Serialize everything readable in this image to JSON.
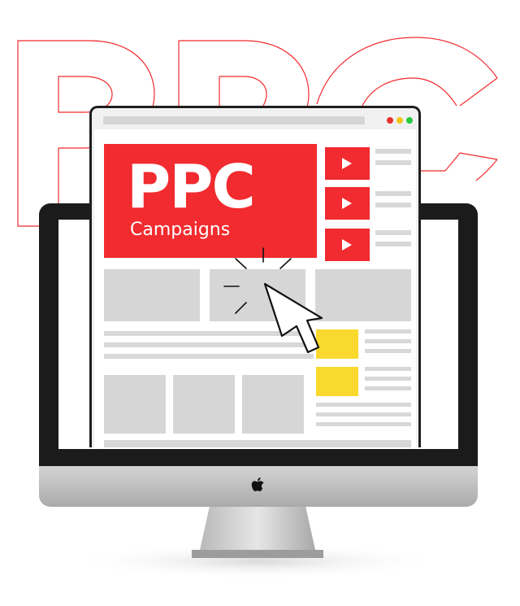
{
  "background_text": "PPC",
  "hero": {
    "title": "PPC",
    "subtitle": "Campaigns"
  },
  "icons": {
    "play": "play-icon",
    "cursor": "mouse-pointer-icon",
    "apple": "apple-logo-icon"
  },
  "colors": {
    "accent_red": "#f12b2f",
    "highlight_yellow": "#f9d92e",
    "placeholder_gray": "#d6d6d6",
    "bezel_black": "#1b1b1b",
    "dot_red": "#e8312b",
    "dot_yellow": "#f5c518",
    "dot_green": "#27c93f"
  }
}
